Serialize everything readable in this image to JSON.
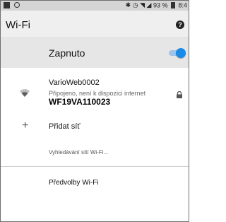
{
  "status_bar": {
    "text": "93 %",
    "clock": "8:4",
    "icons": [
      "image-icon",
      "circle-icon",
      "bluetooth-icon",
      "alarm-icon",
      "wifi-icon",
      "signal-icon",
      "battery-icon"
    ]
  },
  "header": {
    "title": "Wi-Fi",
    "help_icon": "help-icon"
  },
  "master_switch": {
    "label": "Zapnuto",
    "on": true,
    "color": "#1a8ae5"
  },
  "network": {
    "name": "VarioWeb0002",
    "status": "Připojeno, není k dispozici internet",
    "overlay_text": "WF19VA110023",
    "secured": true
  },
  "add_network": {
    "label": "Přidat síť"
  },
  "scanning": {
    "text": "Vyhledávání sítí Wi-Fi..."
  },
  "preferences": {
    "label": "Předvolby Wi-Fi"
  }
}
